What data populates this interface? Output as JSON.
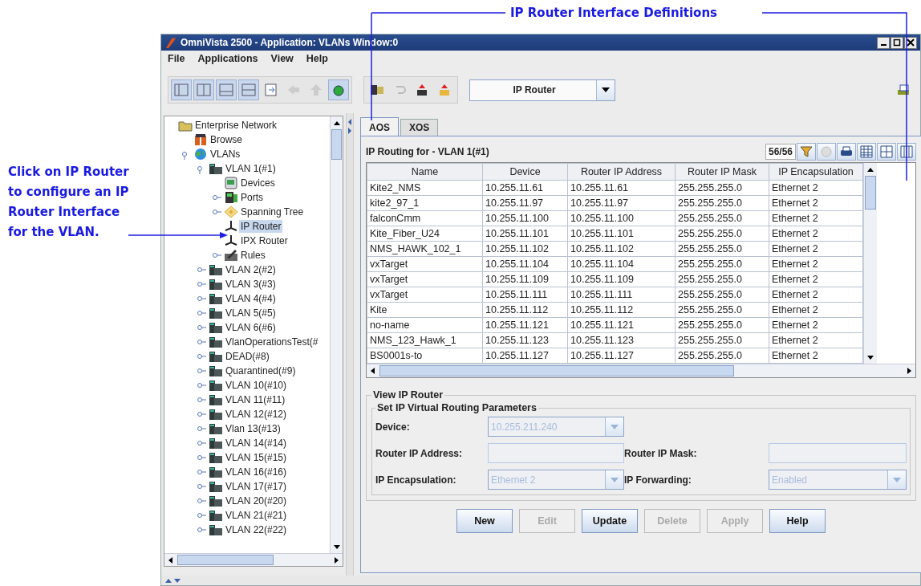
{
  "callout": {
    "text": "IP Router Interface Definitions"
  },
  "annotation": {
    "text": "Click on IP Router to configure an IP Router Interface for the VLAN."
  },
  "window": {
    "title": "OmniVista 2500 -  Application: VLANs  Window:0"
  },
  "menu": [
    "File",
    "Applications",
    "View",
    "Help"
  ],
  "toolbar": {
    "view_selector": "IP Router"
  },
  "tree": [
    {
      "label": "Enterprise Network",
      "kind": "folder",
      "selected": false,
      "children": [
        {
          "label": "Browse",
          "kind": "browse",
          "selected": false
        },
        {
          "label": "VLANs",
          "kind": "globe",
          "selected": false,
          "expanded": true,
          "children": [
            {
              "label": "VLAN 1(#1)",
              "kind": "vlan",
              "selected": false,
              "expanded": true,
              "children": [
                {
                  "label": "Devices",
                  "kind": "devices",
                  "selected": false
                },
                {
                  "label": "Ports",
                  "kind": "ports",
                  "selected": false,
                  "expanded": false
                },
                {
                  "label": "Spanning Tree",
                  "kind": "spanning",
                  "selected": false,
                  "expanded": false
                },
                {
                  "label": "IP Router",
                  "kind": "router",
                  "selected": true
                },
                {
                  "label": "IPX Router",
                  "kind": "router",
                  "selected": false
                },
                {
                  "label": "Rules",
                  "kind": "rules",
                  "selected": false,
                  "expanded": false
                }
              ]
            },
            {
              "label": "VLAN 2(#2)",
              "kind": "vlan",
              "selected": false,
              "expanded": false
            },
            {
              "label": "VLAN 3(#3)",
              "kind": "vlan",
              "selected": false,
              "expanded": false
            },
            {
              "label": "VLAN 4(#4)",
              "kind": "vlan",
              "selected": false,
              "expanded": false
            },
            {
              "label": "VLAN 5(#5)",
              "kind": "vlan",
              "selected": false,
              "expanded": false
            },
            {
              "label": "VLAN 6(#6)",
              "kind": "vlan",
              "selected": false,
              "expanded": false
            },
            {
              "label": "VlanOperationsTest(#",
              "kind": "vlan",
              "selected": false,
              "expanded": false
            },
            {
              "label": "DEAD(#8)",
              "kind": "vlan",
              "selected": false,
              "expanded": false
            },
            {
              "label": "Quarantined(#9)",
              "kind": "vlan",
              "selected": false,
              "expanded": false
            },
            {
              "label": "VLAN 10(#10)",
              "kind": "vlan",
              "selected": false,
              "expanded": false
            },
            {
              "label": "VLAN 11(#11)",
              "kind": "vlan",
              "selected": false,
              "expanded": false
            },
            {
              "label": "VLAN 12(#12)",
              "kind": "vlan",
              "selected": false,
              "expanded": false
            },
            {
              "label": "Vlan 13(#13)",
              "kind": "vlan",
              "selected": false,
              "expanded": false
            },
            {
              "label": "VLAN 14(#14)",
              "kind": "vlan",
              "selected": false,
              "expanded": false
            },
            {
              "label": "VLAN 15(#15)",
              "kind": "vlan",
              "selected": false,
              "expanded": false
            },
            {
              "label": "VLAN 16(#16)",
              "kind": "vlan",
              "selected": false,
              "expanded": false
            },
            {
              "label": "VLAN 17(#17)",
              "kind": "vlan",
              "selected": false,
              "expanded": false
            },
            {
              "label": "VLAN 20(#20)",
              "kind": "vlan",
              "selected": false,
              "expanded": false
            },
            {
              "label": "VLAN 21(#21)",
              "kind": "vlan",
              "selected": false,
              "expanded": false
            },
            {
              "label": "VLAN 22(#22)",
              "kind": "vlan",
              "selected": false,
              "expanded": false
            }
          ]
        }
      ]
    }
  ],
  "tabs": [
    {
      "label": "AOS",
      "selected": true
    },
    {
      "label": "XOS",
      "selected": false
    }
  ],
  "table": {
    "title": "IP Routing for - VLAN 1(#1)",
    "count": "56/56",
    "columns": [
      "Name",
      "Device",
      "Router IP Address",
      "Router IP Mask",
      "IP Encapsulation"
    ],
    "rows": [
      [
        "Kite2_NMS",
        "10.255.11.61",
        "10.255.11.61",
        "255.255.255.0",
        "Ethernet 2"
      ],
      [
        "kite2_97_1",
        "10.255.11.97",
        "10.255.11.97",
        "255.255.255.0",
        "Ethernet 2"
      ],
      [
        "falconCmm",
        "10.255.11.100",
        "10.255.11.100",
        "255.255.255.0",
        "Ethernet 2"
      ],
      [
        "Kite_Fiber_U24",
        "10.255.11.101",
        "10.255.11.101",
        "255.255.255.0",
        "Ethernet 2"
      ],
      [
        "NMS_HAWK_102_1",
        "10.255.11.102",
        "10.255.11.102",
        "255.255.255.0",
        "Ethernet 2"
      ],
      [
        "vxTarget",
        "10.255.11.104",
        "10.255.11.104",
        "255.255.255.0",
        "Ethernet 2"
      ],
      [
        "vxTarget",
        "10.255.11.109",
        "10.255.11.109",
        "255.255.255.0",
        "Ethernet 2"
      ],
      [
        "vxTarget",
        "10.255.11.111",
        "10.255.11.111",
        "255.255.255.0",
        "Ethernet 2"
      ],
      [
        "Kite",
        "10.255.11.112",
        "10.255.11.112",
        "255.255.255.0",
        "Ethernet 2"
      ],
      [
        "no-name",
        "10.255.11.121",
        "10.255.11.121",
        "255.255.255.0",
        "Ethernet 2"
      ],
      [
        "NMS_123_Hawk_1",
        "10.255.11.123",
        "10.255.11.123",
        "255.255.255.0",
        "Ethernet 2"
      ],
      [
        "BS0001s-to",
        "10.255.11.127",
        "10.255.11.127",
        "255.255.255.0",
        "Ethernet 2"
      ]
    ]
  },
  "form": {
    "title": "View IP Router",
    "group_title": "Set IP Virtual Routing Parameters",
    "fields": [
      {
        "label": "Device:",
        "kind": "combo",
        "value": "10.255.211.240",
        "disabled": true
      },
      {
        "label": "Router IP Address:",
        "kind": "text",
        "disabled": true
      },
      {
        "label": "Router IP Mask:",
        "kind": "text",
        "disabled": true
      },
      {
        "label": "IP Encapsulation:",
        "kind": "combo",
        "value": "Ethernet 2",
        "disabled": true
      },
      {
        "label": "IP Forwarding:",
        "kind": "combo",
        "value": "Enabled",
        "disabled": true
      }
    ]
  },
  "buttons": [
    {
      "label": "New",
      "disabled": false
    },
    {
      "label": "Edit",
      "disabled": true
    },
    {
      "label": "Update",
      "disabled": false
    },
    {
      "label": "Delete",
      "disabled": true
    },
    {
      "label": "Apply",
      "disabled": true
    },
    {
      "label": "Help",
      "disabled": false
    }
  ]
}
